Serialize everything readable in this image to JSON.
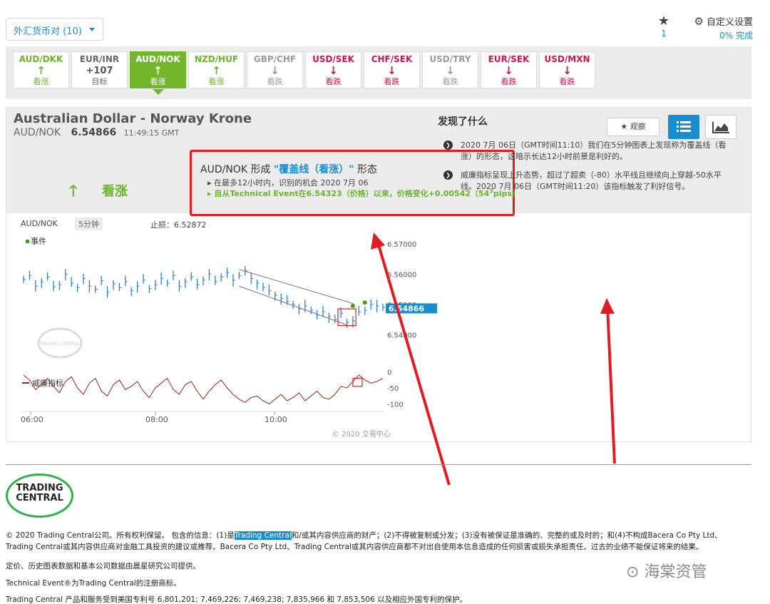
{
  "top": {
    "pair_selector": "外汇货币对 (10)",
    "favorites_count": "1",
    "settings_label": "自定义设置",
    "settings_progress": "0% 完成"
  },
  "tiles": [
    {
      "symbol": "AUD/DKK",
      "arrow": "↑",
      "label": "看涨",
      "state": "up"
    },
    {
      "symbol": "EUR/INR",
      "arrow": "+107",
      "label": "目标",
      "state": "target"
    },
    {
      "symbol": "AUD/NOK",
      "arrow": "↑",
      "label": "看涨",
      "state": "active"
    },
    {
      "symbol": "NZD/HUF",
      "arrow": "↑",
      "label": "看涨",
      "state": "up"
    },
    {
      "symbol": "GBP/CHF",
      "arrow": "↓",
      "label": "看跌",
      "state": "neutral"
    },
    {
      "symbol": "USD/SEK",
      "arrow": "↓",
      "label": "看跌",
      "state": "down"
    },
    {
      "symbol": "CHF/SEK",
      "arrow": "↓",
      "label": "看跌",
      "state": "down"
    },
    {
      "symbol": "USD/TRY",
      "arrow": "↓",
      "label": "看跌",
      "state": "neutral"
    },
    {
      "symbol": "EUR/SEK",
      "arrow": "↓",
      "label": "看跌",
      "state": "down"
    },
    {
      "symbol": "USD/MXN",
      "arrow": "↓",
      "label": "看跌",
      "state": "down"
    }
  ],
  "instrument": {
    "title": "Australian Dollar - Norway Krone",
    "symbol": "AUD/NOK",
    "price": "6.54866",
    "time": "11:49:15 GMT",
    "watch_label": "观察"
  },
  "signal": {
    "direction_label": "看涨",
    "title_prefix": "AUD/NOK 形成 ",
    "pattern": "\"覆盖线（看涨）\"",
    "title_suffix": " 形态",
    "line1": "在最多12小时内，识别的机会 2020 7月 06",
    "line2_a": "自从Technical Event在6.54323（价格）以来，价格变化+0.00542（54",
    "line2_sup": "3",
    "line2_b": "pips）"
  },
  "chart_labels": {
    "symbol": "AUD/NOK",
    "interval": "5分钟",
    "stop_loss": "止损：6.52872",
    "event_legend": "事件",
    "indicator_legend": "威廉指标",
    "copyright": "© 2020 交易中心",
    "watermark": "TRADING CENTRAL"
  },
  "chart_data": {
    "type": "ohlc",
    "x_ticks": [
      "06:00",
      "08:00",
      "10:00"
    ],
    "y_ticks": [
      "6.57000",
      "6.56000",
      "6.55000",
      "6.54000"
    ],
    "y_range": [
      6.533,
      6.573
    ],
    "current_price": "6.54866",
    "indicator_ticks": [
      "0",
      "-50",
      "-100"
    ],
    "indicator_range": [
      -110,
      10
    ],
    "close_series": [
      6.5582,
      6.5595,
      6.556,
      6.5575,
      6.559,
      6.5558,
      6.5565,
      6.56,
      6.557,
      6.5555,
      6.5585,
      6.556,
      6.555,
      6.5578,
      6.554,
      6.5568,
      6.5555,
      6.5575,
      6.5545,
      6.556,
      6.558,
      6.5552,
      6.5565,
      6.5585,
      6.557,
      6.5595,
      6.556,
      6.5575,
      6.559,
      6.5565,
      6.558,
      6.56,
      6.5575,
      6.559,
      6.5605,
      6.558,
      6.5595,
      6.561,
      6.5585,
      6.557,
      6.5555,
      6.5545,
      6.553,
      6.552,
      6.551,
      6.55,
      6.5485,
      6.5495,
      6.548,
      6.5465,
      6.5475,
      6.546,
      6.545,
      6.547,
      6.544,
      6.5445,
      6.5475,
      6.548,
      6.55,
      6.5495,
      6.549
    ],
    "williams_series": [
      -10,
      -25,
      -55,
      -40,
      -20,
      -45,
      -65,
      -30,
      -15,
      -50,
      -70,
      -35,
      -20,
      -60,
      -75,
      -40,
      -25,
      -55,
      -45,
      -30,
      -60,
      -80,
      -50,
      -35,
      -20,
      -55,
      -70,
      -40,
      -30,
      -60,
      -85,
      -60,
      -40,
      -25,
      -50,
      -70,
      -85,
      -95,
      -80,
      -75,
      -90,
      -100,
      -85,
      -70,
      -90,
      -80,
      -65,
      -90,
      -75,
      -60,
      -80,
      -85,
      -70,
      -45,
      -50,
      -30,
      -10,
      -25,
      -35,
      -30,
      -20
    ]
  },
  "findings": {
    "title": "发现了什么",
    "items": [
      "2020 7月 06日（GMT时间11:10）我们在5分钟图表上发现称为覆盖线（看涨）的形态，这暗示长达12小时前景是利好的。",
      "威廉指标呈现上升态势，超过了超卖（-80）水平线且继续向上穿越-50水平线。2020 7月 06日（GMT时间11:20）该指标触发了利好信号。"
    ]
  },
  "footer": {
    "logo_line1": "TRADING",
    "logo_line2": "CENTRAL",
    "p1_a": "© 2020 Trading Central公司。所有权利保留。 包含的信息：(1)是",
    "p1_hl": "Trading Central",
    "p1_b": "和/或其内容供应商的财产；(2)不得被复制或分发；(3)没有被保证是准确的、完整的或及时的；和(4)不构成Bacera Co Pty Ltd、",
    "p1_c": "Trading Central或其内容供应商对金融工具投资的建议或推荐。Bacera Co Pty Ltd、Trading Central或其内容供应商都不对出自使用本信息造成的任何损害或损失承担责任。过去的业绩不能保证将来的结果。",
    "p2": "定价、历史图表数据和基本公司数据由晨星研究公司提供。",
    "p3": "Technical Event®为Trading Central的注册商标。",
    "p4": "Trading Central 产品和服务受到美国专利号 6,801,201; 7,469,226; 7,469,238; 7,835,966 和 7,853,506 以及相应外国专利的保护。",
    "watermark": "海棠资管"
  }
}
